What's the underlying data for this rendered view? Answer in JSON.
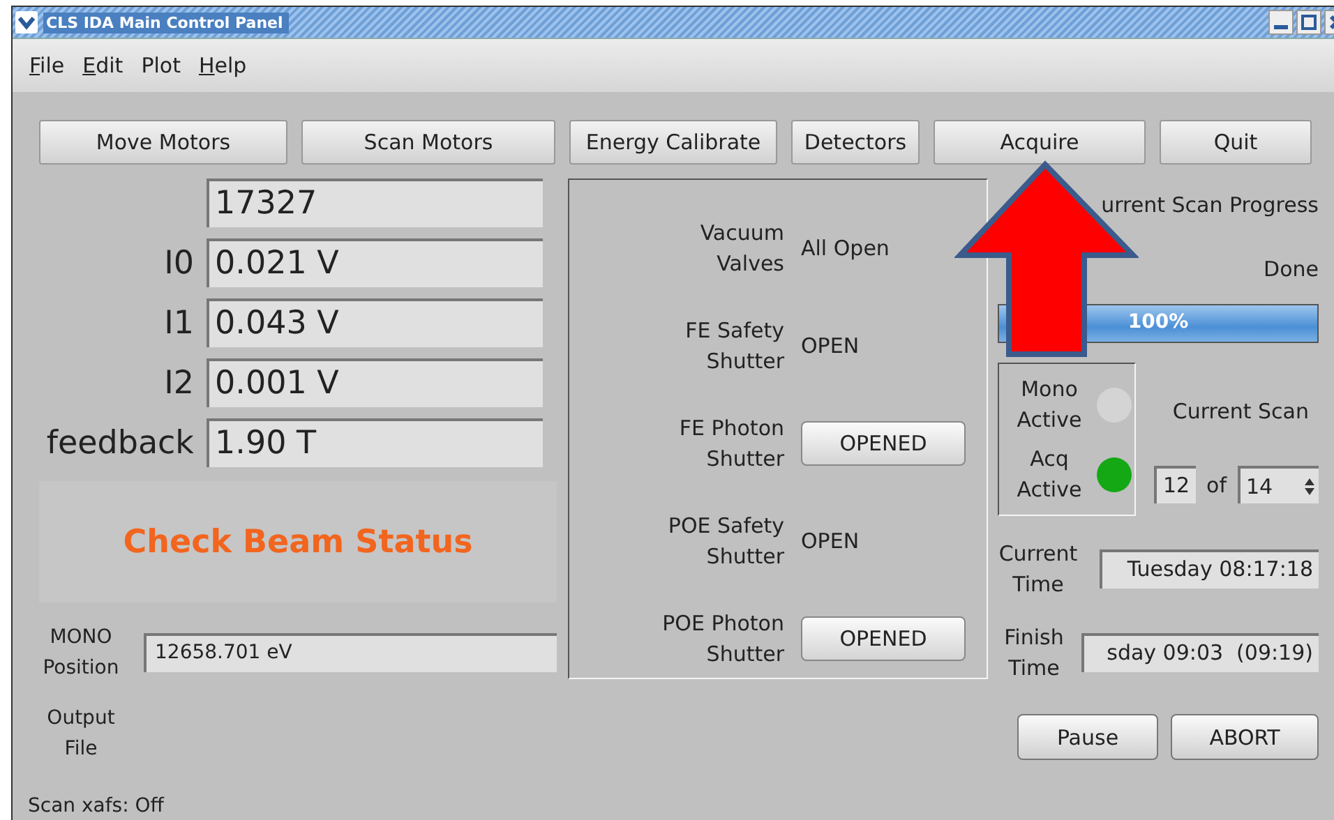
{
  "window": {
    "title": "CLS IDA Main Control Panel"
  },
  "menu": [
    {
      "label": "File",
      "mnemonic": true
    },
    {
      "label": "Edit",
      "mnemonic": true
    },
    {
      "label": "Plot",
      "mnemonic": false
    },
    {
      "label": "Help",
      "mnemonic": true
    }
  ],
  "toolbar": [
    "Move Motors",
    "Scan Motors",
    "Energy Calibrate",
    "Detectors",
    "Acquire",
    "Quit"
  ],
  "readings": [
    {
      "value": "17327"
    },
    {
      "label": "I0",
      "value": "0.021 V"
    },
    {
      "label": "I1",
      "value": "0.043 V"
    },
    {
      "label": "I2",
      "value": "0.001 V"
    },
    {
      "label": "feedback",
      "value": "1.90 T"
    }
  ],
  "beam_status": "Check Beam Status",
  "mono_position": {
    "label": "MONO Position",
    "value": "12658.701 eV"
  },
  "output_file": {
    "label": "Output File"
  },
  "shutters": [
    {
      "label": "Vacuum Valves",
      "kind": "text",
      "value": "All Open"
    },
    {
      "label": "FE Safety Shutter",
      "kind": "text",
      "value": "OPEN"
    },
    {
      "label": "FE Photon Shutter",
      "kind": "button",
      "value": "OPENED"
    },
    {
      "label": "POE Safety Shutter",
      "kind": "text",
      "value": "OPEN"
    },
    {
      "label": "POE Photon Shutter",
      "kind": "button",
      "value": "OPENED"
    }
  ],
  "progress": {
    "title": "urrent Scan Progress",
    "status": "Done",
    "level": 1,
    "reading": "100%"
  },
  "indicators": [
    {
      "label": "Mono Active",
      "on": false
    },
    {
      "label": "Acq Active",
      "on": true
    }
  ],
  "current_scan": {
    "label": "Current Scan",
    "index": "12",
    "of": "of",
    "total": "14"
  },
  "current_time": {
    "label": "Current Time",
    "value": "Tuesday 08:17:18"
  },
  "finish_time": {
    "label": "Finish Time",
    "value": "sday 09:03  (09:19)"
  },
  "actions": [
    "Pause",
    "ABORT"
  ],
  "status_bar": "Scan xafs: Off"
}
